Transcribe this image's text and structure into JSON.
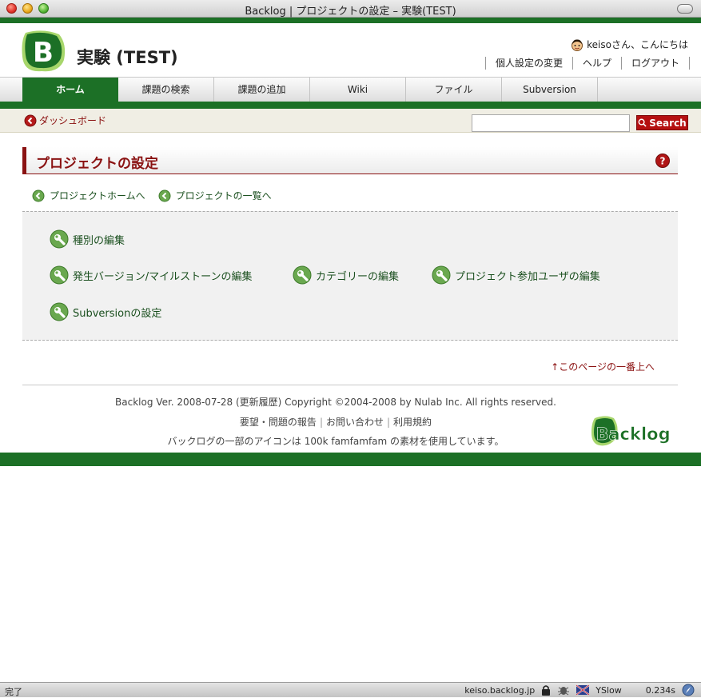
{
  "window": {
    "title": "Backlog | プロジェクトの設定 – 実験(TEST)"
  },
  "header": {
    "logo_letter": "B",
    "project_title": "実験 (TEST)",
    "greeting": "keisoさん、こんにちは",
    "user_menu": [
      "個人設定の変更",
      "ヘルプ",
      "ログアウト"
    ]
  },
  "nav": {
    "tabs": [
      {
        "label": "ホーム"
      },
      {
        "label": "課題の検索"
      },
      {
        "label": "課題の追加"
      },
      {
        "label": "Wiki"
      },
      {
        "label": "ファイル"
      },
      {
        "label": "Subversion"
      }
    ]
  },
  "subbar": {
    "dashboard_link": "ダッシュボード",
    "search_value": "",
    "search_button": "Search"
  },
  "page": {
    "heading": "プロジェクトの設定",
    "back_links": [
      "プロジェクトホームへ",
      "プロジェクトの一覧へ"
    ],
    "settings": [
      "種別の編集",
      "発生バージョン/マイルストーンの編集",
      "カテゴリーの編集",
      "プロジェクト参加ユーザの編集",
      "Subversionの設定"
    ],
    "to_top": "↑このページの一番上へ"
  },
  "footer": {
    "backlog": "Backlog",
    "version": " Ver. 2008-07-28 (",
    "history": "更新履歴",
    "copyright": ") Copyright ©2004-2008 by ",
    "company": "Nulab Inc.",
    "rights": " All rights reserved.",
    "links": [
      "要望・問題の報告",
      "お問い合わせ",
      "利用規約"
    ],
    "icons_prefix": "バックログの一部のアイコンは ",
    "icons_link1": "100k",
    "icons_link2": "famfamfam",
    "icons_suffix": " の素材を使用しています。",
    "logo_text": "Backlog"
  },
  "statusbar": {
    "status": "完了",
    "host": "keiso.backlog.jp",
    "yslow": "YSlow",
    "time": "0.234s"
  },
  "colors": {
    "brand_green": "#1c7026",
    "accent_red": "#8a1212",
    "search_red": "#b51010"
  }
}
